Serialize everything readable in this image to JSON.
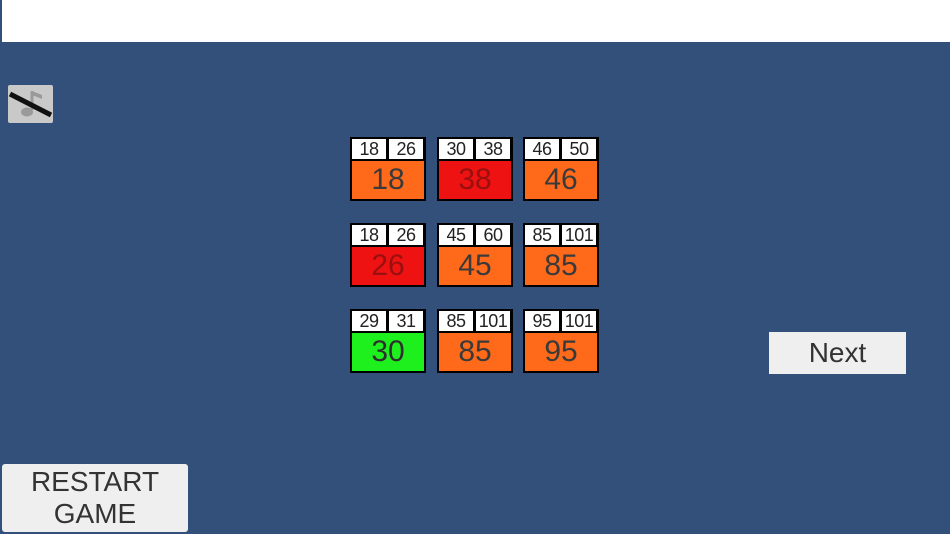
{
  "icons": {
    "music_toggle": "music-muted-icon"
  },
  "colors": {
    "background": "#325079",
    "tile_orange": "#ff6a1a",
    "tile_red": "#ef1212",
    "tile_green": "#1ef01e"
  },
  "grid": {
    "cells": [
      {
        "lo": "18",
        "hi": "26",
        "value": "18",
        "state": "orange"
      },
      {
        "lo": "30",
        "hi": "38",
        "value": "38",
        "state": "red"
      },
      {
        "lo": "46",
        "hi": "50",
        "value": "46",
        "state": "orange"
      },
      {
        "lo": "18",
        "hi": "26",
        "value": "26",
        "state": "red"
      },
      {
        "lo": "45",
        "hi": "60",
        "value": "45",
        "state": "orange"
      },
      {
        "lo": "85",
        "hi": "101",
        "value": "85",
        "state": "orange"
      },
      {
        "lo": "29",
        "hi": "31",
        "value": "30",
        "state": "green"
      },
      {
        "lo": "85",
        "hi": "101",
        "value": "85",
        "state": "orange"
      },
      {
        "lo": "95",
        "hi": "101",
        "value": "95",
        "state": "orange"
      }
    ]
  },
  "buttons": {
    "next": "Next",
    "restart_line1": "RESTART",
    "restart_line2": "GAME"
  }
}
